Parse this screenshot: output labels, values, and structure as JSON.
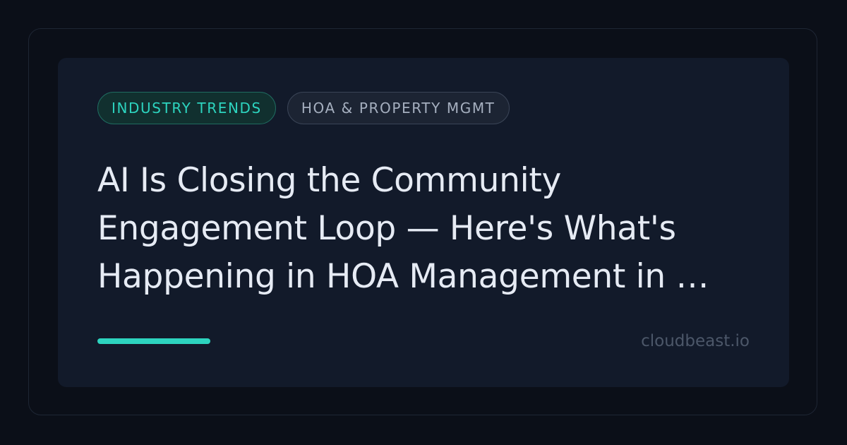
{
  "tags": [
    {
      "label": "INDUSTRY TRENDS"
    },
    {
      "label": "HOA & PROPERTY MGMT"
    }
  ],
  "headline": {
    "line1": "AI Is Closing the Community",
    "line2": "Engagement Loop — Here's What's",
    "line3": "Happening in HOA Management in …"
  },
  "footer": {
    "site": "cloudbeast.io"
  },
  "colors": {
    "background": "#0b0f18",
    "card": "#121a2a",
    "accent": "#2dd4bf",
    "headline_text": "#e6ebf4",
    "muted_text": "#4c5769"
  }
}
